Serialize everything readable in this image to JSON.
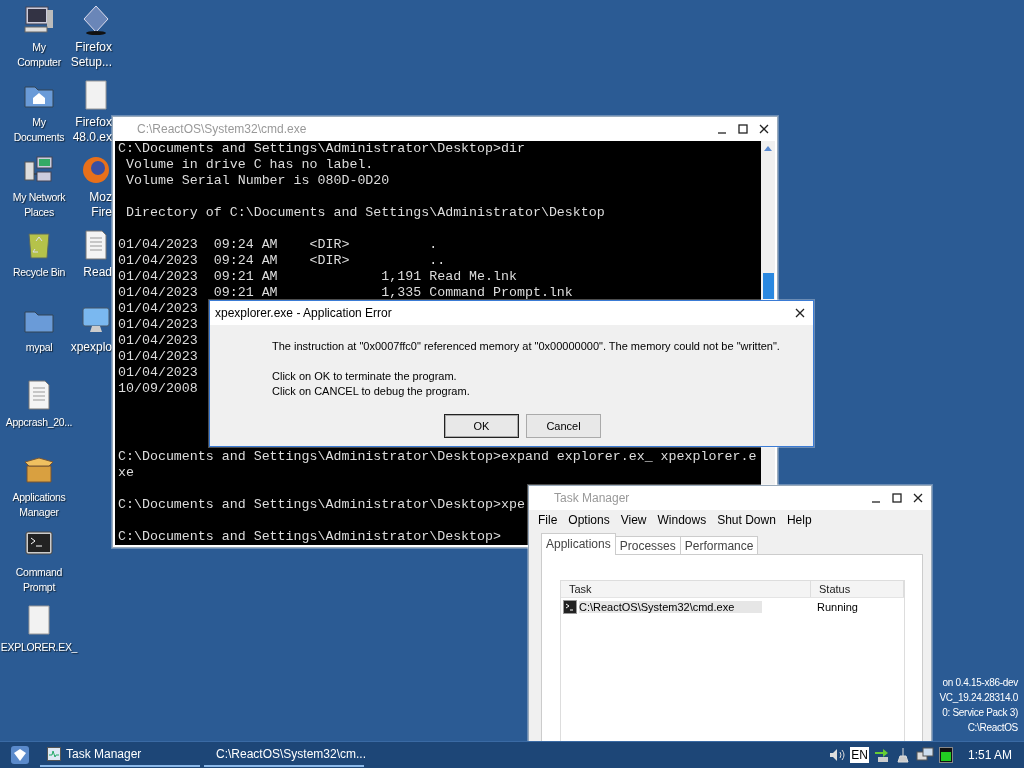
{
  "desktop_columns": [
    {
      "icons": [
        {
          "kind": "computer",
          "lines": [
            "My",
            "Computer"
          ]
        },
        {
          "kind": "folder-home",
          "lines": [
            "My",
            "Documents"
          ]
        },
        {
          "kind": "network",
          "lines": [
            "My Network",
            "Places"
          ]
        },
        {
          "kind": "recycle",
          "lines": [
            "Recycle Bin"
          ]
        },
        {
          "kind": "folder",
          "lines": [
            "mypal"
          ]
        },
        {
          "kind": "document",
          "lines": [
            "Appcrash_20..."
          ]
        },
        {
          "kind": "package",
          "lines": [
            "Applications",
            "Manager"
          ]
        },
        {
          "kind": "terminal",
          "lines": [
            "Command",
            "Prompt"
          ]
        },
        {
          "kind": "blank",
          "lines": [
            "EXPLORER.EX_"
          ]
        }
      ]
    },
    {
      "icons": [
        {
          "kind": "setup",
          "lines": [
            "Firefox",
            "Setup..."
          ]
        },
        {
          "kind": "blank",
          "lines": [
            "Firefox",
            "48.0.ex"
          ]
        },
        {
          "kind": "firefox",
          "lines": [
            "Moz",
            "Fire"
          ]
        },
        {
          "kind": "document",
          "lines": [
            "Read"
          ]
        },
        {
          "kind": "monitor",
          "lines": [
            "xpexplo"
          ]
        }
      ]
    }
  ],
  "os_info": [
    "on 0.4.15-x86-dev",
    "VC_19.24.28314.0",
    "0: Service Pack 3)",
    "C:\\ReactOS"
  ],
  "cmd_window": {
    "title": "C:\\ReactOS\\System32\\cmd.exe",
    "active": false,
    "top_blocks": [
      [
        "C:\\Documents and Settings\\Administrator\\Desktop>dir",
        " Volume in drive C has no label.",
        " Volume Serial Number is 080D-0D20"
      ],
      [
        " Directory of C:\\Documents and Settings\\Administrator\\Desktop"
      ],
      [
        "01/04/2023  09:24 AM    <DIR>          .",
        "01/04/2023  09:24 AM    <DIR>          ..",
        "01/04/2023  09:21 AM             1,191 Read Me.lnk",
        "01/04/2023  09:21 AM             1,335 Command Prompt.lnk",
        "01/04/2023",
        "01/04/2023",
        "01/04/2023",
        "01/04/2023",
        "01/04/2023",
        "10/09/2008"
      ]
    ],
    "bottom_blocks": [
      [
        "C:\\Documents and Settings\\Administrator\\Desktop>expand explorer.ex_ xpexplorer.e",
        "xe"
      ],
      [
        "C:\\Documents and Settings\\Administrator\\Desktop>xpe"
      ],
      [
        "C:\\Documents and Settings\\Administrator\\Desktop>"
      ]
    ]
  },
  "error_dialog": {
    "title": "xpexplorer.exe - Application Error",
    "active": true,
    "message": "The instruction at \"0x0007ffc0\" referenced memory at \"0x00000000\". The memory could not be \"written\".",
    "instructions": [
      "Click on OK to terminate the program.",
      "Click on CANCEL to debug the program."
    ],
    "buttons": [
      {
        "label": "OK",
        "default": true
      },
      {
        "label": "Cancel",
        "default": false
      }
    ]
  },
  "task_manager": {
    "title": "Task Manager",
    "active": false,
    "menu": [
      "File",
      "Options",
      "View",
      "Windows",
      "Shut Down",
      "Help"
    ],
    "tabs": [
      {
        "label": "Applications",
        "selected": true
      },
      {
        "label": "Processes",
        "selected": false
      },
      {
        "label": "Performance",
        "selected": false
      }
    ],
    "columns": [
      "Task",
      "Status"
    ],
    "rows": [
      {
        "task": "C:\\ReactOS\\System32\\cmd.exe",
        "status": "Running",
        "selected": true
      }
    ]
  },
  "taskbar": {
    "buttons": [
      {
        "kind": "taskmgr",
        "label": "Task Manager"
      },
      {
        "kind": "terminal",
        "label": "C:\\ReactOS\\System32\\cm..."
      }
    ],
    "language": "EN",
    "clock": "1:51 AM"
  }
}
